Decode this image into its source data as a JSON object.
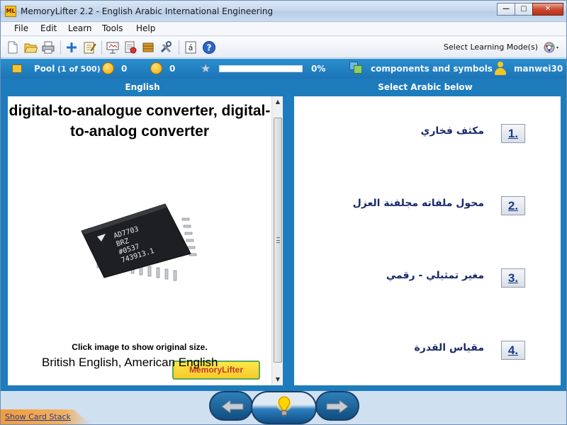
{
  "window": {
    "title": "MemoryLifter 2.2 - English Arabic International Engineering",
    "app_icon_text": "ML"
  },
  "menu": [
    "File",
    "Edit",
    "Learn",
    "Tools",
    "Help"
  ],
  "toolbar": {
    "icons": [
      "new-document-icon",
      "open-folder-icon",
      "print-icon",
      "add-icon",
      "edit-icon",
      "slideshow-icon",
      "statistics-icon",
      "box-icon",
      "tools-icon",
      "special-char-icon",
      "help-icon"
    ],
    "special_char_label": "á",
    "help_label": "?",
    "learning_mode_label": "Select Learning Mode(s)"
  },
  "status": {
    "pool_label": "Pool",
    "pool_count": "(1 of 500)",
    "right_count": "0",
    "wrong_count": "0",
    "progress_fraction": 0.0,
    "progress_text": "0%",
    "chapter": "components and symbols",
    "user": "manwei30"
  },
  "question_pane": {
    "header": "English",
    "word": "digital-to-analogue converter, digital-to-analog converter",
    "chip_text": [
      "AD7703",
      "BRZ",
      "#0537",
      "743913.1"
    ],
    "hint": "Click image to show original size.",
    "language_note": "British English, American English",
    "logo_text": "MemoryLifter"
  },
  "answer_pane": {
    "header": "Select Arabic below",
    "choices": [
      {
        "number": "1.",
        "text": "مكثف فخاري"
      },
      {
        "number": "2.",
        "text": "محول ملفاته مجلفنة العزل"
      },
      {
        "number": "3.",
        "text": "مغير تمثيلي - رقمي"
      },
      {
        "number": "4.",
        "text": "مقياس القدرة"
      }
    ]
  },
  "bottom": {
    "show_card_stack": "Show Card Stack"
  },
  "colors": {
    "accent_blue": "#1e7cbd",
    "status_blue": "#2a8fcf",
    "answer_text": "#1a2a6b"
  }
}
